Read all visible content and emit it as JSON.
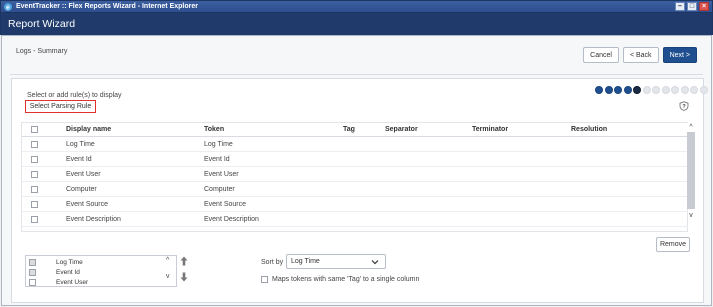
{
  "window": {
    "title": "EventTracker :: Flex Reports Wizard - Internet Explorer",
    "controls": [
      "minimize-icon",
      "maximize-icon",
      "close-icon"
    ]
  },
  "wizard": {
    "title": "Report Wizard"
  },
  "page": {
    "breadcrumb": "Logs - Summary",
    "buttons": {
      "cancel": "Cancel",
      "back": "< Back",
      "next": "Next >"
    }
  },
  "panel": {
    "instruction": "Select or add rule(s) to display",
    "select_parsing_rule": "Select Parsing Rule",
    "progress": {
      "total_steps": 12,
      "completed_steps": 4,
      "current_step": 5
    },
    "table": {
      "columns": [
        "Display name",
        "Token",
        "Tag",
        "Separator",
        "Terminator",
        "Resolution"
      ],
      "rows": [
        {
          "display_name": "Log Time",
          "token": "Log Time",
          "tag": "",
          "separator": "",
          "terminator": "",
          "resolution": ""
        },
        {
          "display_name": "Event Id",
          "token": "Event Id",
          "tag": "",
          "separator": "",
          "terminator": "",
          "resolution": ""
        },
        {
          "display_name": "Event User",
          "token": "Event User",
          "tag": "",
          "separator": "",
          "terminator": "",
          "resolution": ""
        },
        {
          "display_name": "Computer",
          "token": "Computer",
          "tag": "",
          "separator": "",
          "terminator": "",
          "resolution": ""
        },
        {
          "display_name": "Event Source",
          "token": "Event Source",
          "tag": "",
          "separator": "",
          "terminator": "",
          "resolution": ""
        },
        {
          "display_name": "Event Description",
          "token": "Event Description",
          "tag": "",
          "separator": "",
          "terminator": "",
          "resolution": ""
        }
      ]
    },
    "remove_label": "Remove",
    "selected_items": [
      "Log Time",
      "Event Id",
      "Event User"
    ],
    "sort_by": {
      "label": "Sort by",
      "value": "Log Time"
    },
    "maps_tokens_label": "Maps tokens with same 'Tag' to a single column"
  },
  "colors": {
    "header_blue": "#1f3a6b",
    "primary_button": "#1f4f8f",
    "highlight_red": "#e0312f"
  }
}
